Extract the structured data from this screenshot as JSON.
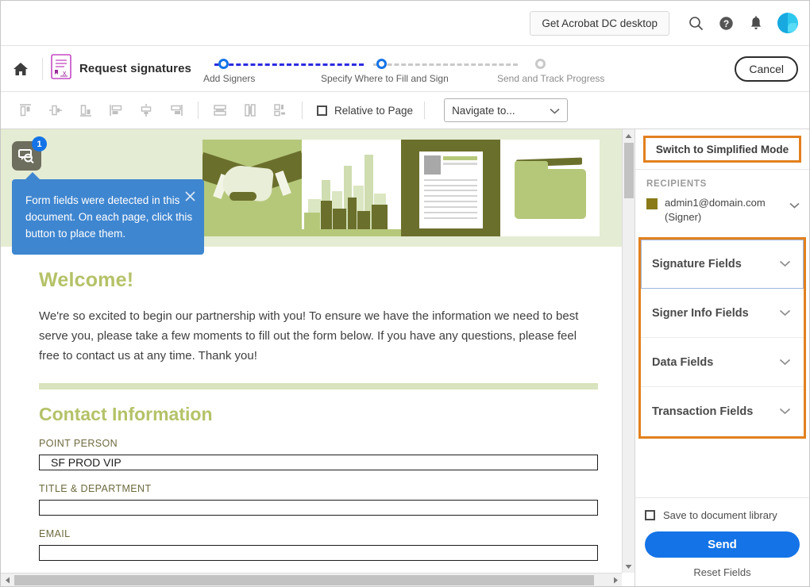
{
  "header": {
    "get_acrobat_label": "Get Acrobat DC desktop",
    "search_icon": "search-icon",
    "help_icon": "help-icon",
    "bell_icon": "notifications-bell-icon",
    "avatar_icon": "user-avatar"
  },
  "workflow": {
    "home_icon": "home-icon",
    "app_icon": "request-signatures-document-icon",
    "title": "Request signatures",
    "cancel_label": "Cancel",
    "steps": [
      {
        "label": "Add Signers",
        "state": "done"
      },
      {
        "label": "Specify Where to Fill and Sign",
        "state": "active"
      },
      {
        "label": "Send and Track Progress",
        "state": "pending"
      }
    ]
  },
  "toolbar": {
    "align_icons": [
      "align-top-icon",
      "align-center-horizontal-icon",
      "align-bottom-icon",
      "align-left-icon",
      "align-middle-vertical-icon",
      "align-right-icon"
    ],
    "distribute_icons": [
      "distribute-horizontal-icon",
      "distribute-vertical-icon",
      "match-size-icon"
    ],
    "relative_to_page_label": "Relative to Page",
    "relative_to_page_checked": false,
    "navigate_value": "Navigate to...",
    "navigate_caret_icon": "chevron-down-icon"
  },
  "callout": {
    "badge": "1",
    "button_icon": "place-form-fields-icon",
    "message": "Form fields were detected in this document. On each page, click this button to place them.",
    "close_icon": "close-icon"
  },
  "document": {
    "banner_alt": "handshake-city-resume-folder-banner",
    "heading": "Welcome!",
    "paragraph": "We're so excited to begin our partnership with you! To ensure we have the information we need to best serve you, please take a few moments to fill out the form below. If you have any questions, please feel free to contact us at any time. Thank you!",
    "section_heading": "Contact Information",
    "fields": [
      {
        "label": "POINT PERSON",
        "value": "SF PROD VIP"
      },
      {
        "label": "TITLE & DEPARTMENT",
        "value": ""
      },
      {
        "label": "EMAIL",
        "value": ""
      }
    ]
  },
  "sidebar": {
    "switch_mode_label": "Switch to Simplified Mode",
    "recipients_title": "RECIPIENTS",
    "recipient": {
      "email": "admin1@domain.com",
      "role": "(Signer)",
      "swatch_color": "#8a7a18",
      "caret_icon": "chevron-down-icon"
    },
    "field_groups": [
      {
        "label": "Signature Fields",
        "caret_icon": "chevron-down-icon",
        "selected": true
      },
      {
        "label": "Signer Info Fields",
        "caret_icon": "chevron-down-icon",
        "selected": false
      },
      {
        "label": "Data Fields",
        "caret_icon": "chevron-down-icon",
        "selected": false
      },
      {
        "label": "Transaction Fields",
        "caret_icon": "chevron-down-icon",
        "selected": false
      }
    ],
    "save_library_label": "Save to document library",
    "save_library_checked": false,
    "send_label": "Send",
    "reset_label": "Reset Fields"
  },
  "colors": {
    "accent_blue": "#1473e6",
    "highlight_orange": "#e2801e",
    "doc_green": "#b5c268",
    "step_blue": "#2c2ce0"
  }
}
